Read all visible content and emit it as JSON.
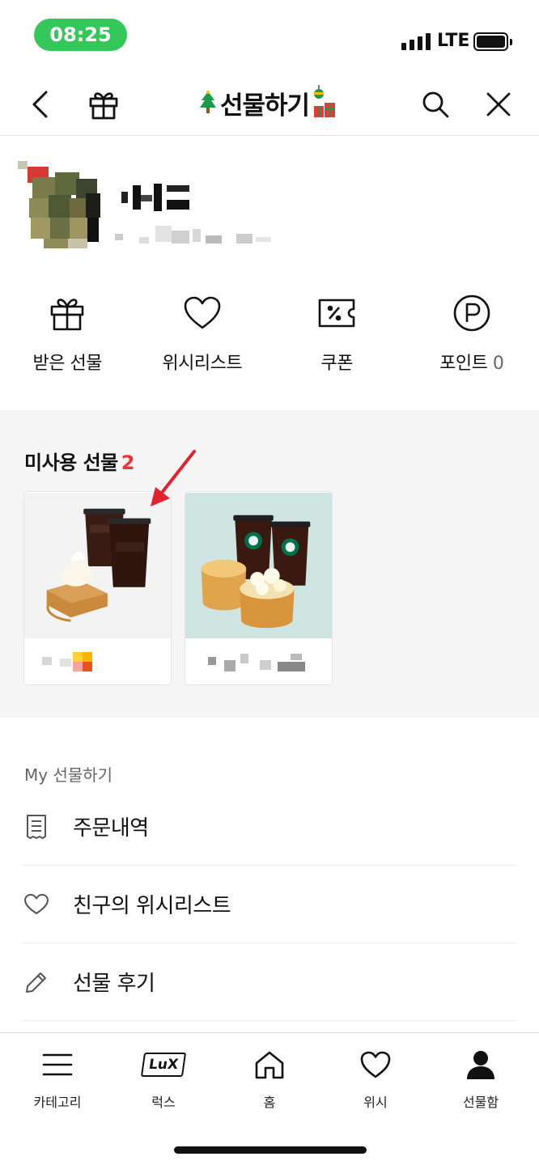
{
  "status_bar": {
    "time": "08:25",
    "network": "LTE",
    "time_pill_color": "#34c759"
  },
  "header": {
    "title": "선물하기",
    "back_icon": "chevron-left-icon",
    "gift_icon": "gift-icon",
    "search_icon": "search-icon",
    "close_icon": "close-icon"
  },
  "profile": {
    "avatar_icon": "avatar-icon"
  },
  "quick_menu": {
    "items": [
      {
        "label": "받은 선물",
        "icon": "gift-box-icon"
      },
      {
        "label": "위시리스트",
        "icon": "heart-icon"
      },
      {
        "label": "쿠폰",
        "icon": "coupon-icon"
      },
      {
        "label": "포인트",
        "icon": "point-icon",
        "count": "0"
      }
    ]
  },
  "unused_gifts": {
    "title": "미사용 선물",
    "count": "2",
    "count_color": "#f0313b",
    "cards": [
      {
        "image": "ediya-coffee-toast-image"
      },
      {
        "image": "starbucks-coffee-cake-image"
      }
    ]
  },
  "my_gifts": {
    "title": "My 선물하기",
    "rows": [
      {
        "label": "주문내역",
        "icon": "receipt-icon"
      },
      {
        "label": "친구의 위시리스트",
        "icon": "heart-outline-icon"
      },
      {
        "label": "선물 후기",
        "icon": "pencil-icon"
      }
    ]
  },
  "bottom_nav": {
    "items": [
      {
        "label": "카테고리",
        "icon": "menu-icon"
      },
      {
        "label": "럭스",
        "icon": "lux-icon",
        "badge_text": "LuX"
      },
      {
        "label": "홈",
        "icon": "home-icon"
      },
      {
        "label": "위시",
        "icon": "heart-icon"
      },
      {
        "label": "선물함",
        "icon": "person-icon"
      }
    ]
  }
}
